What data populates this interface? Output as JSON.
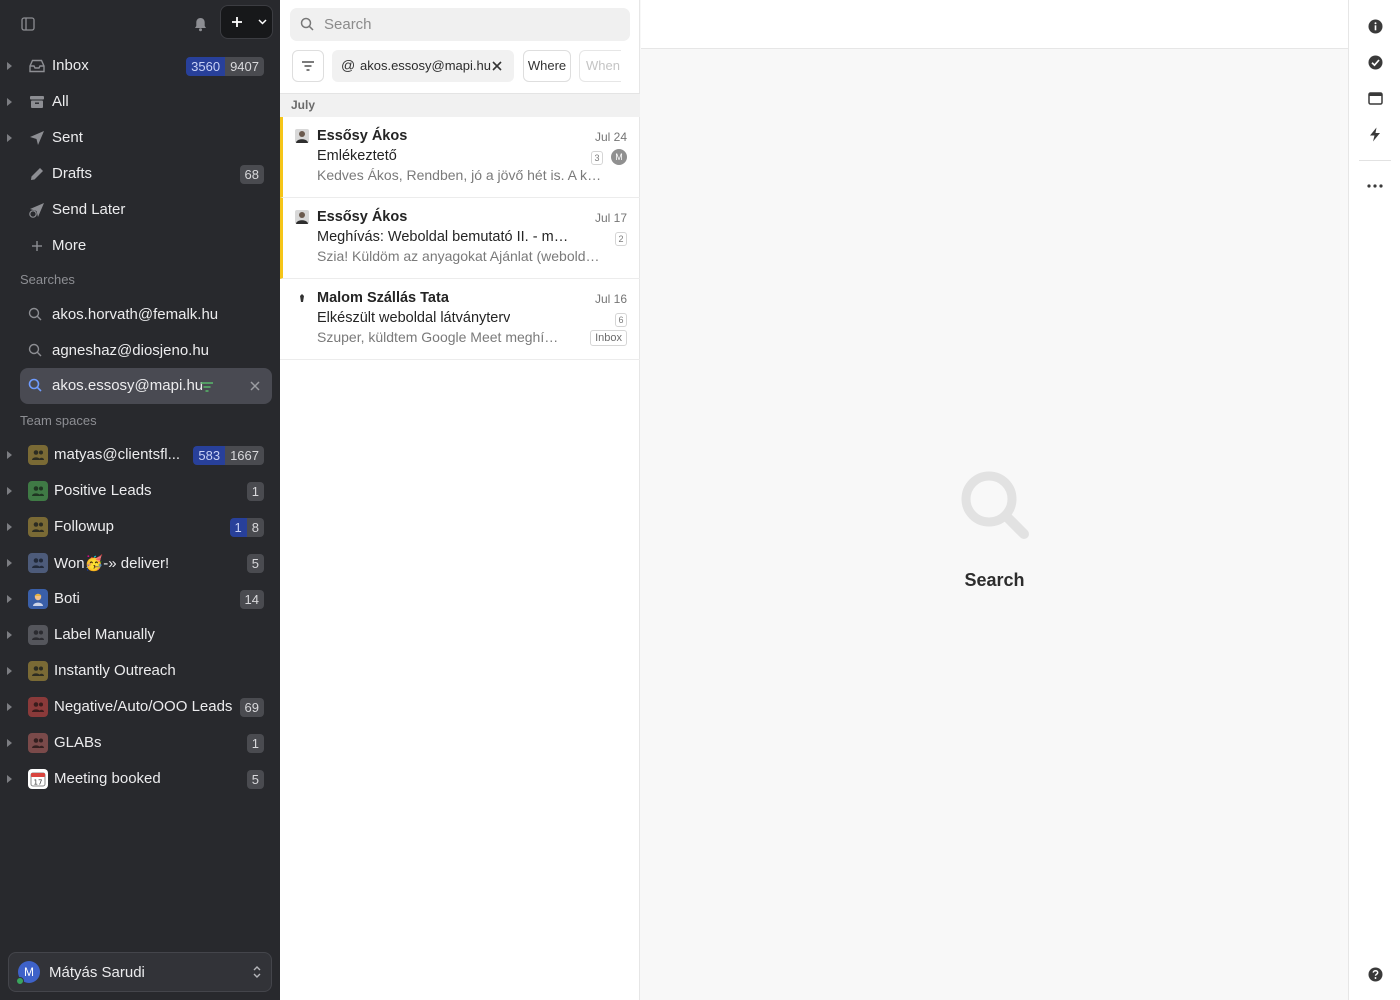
{
  "sidebar": {
    "nav": [
      {
        "label": "Inbox",
        "badge_blue": "3560",
        "badge_grey": "9407"
      },
      {
        "label": "All"
      },
      {
        "label": "Sent"
      },
      {
        "label": "Drafts",
        "badge_grey": "68"
      },
      {
        "label": "Send Later"
      },
      {
        "label": "More"
      }
    ],
    "searches_heading": "Searches",
    "searches": [
      {
        "label": "akos.horvath@femalk.hu"
      },
      {
        "label": "agneshaz@diosjeno.hu"
      },
      {
        "label": "akos.essosy@mapi.hu"
      }
    ],
    "team_heading": "Team spaces",
    "teams": [
      {
        "label": "matyas@clientsfl...",
        "badge_blue": "583",
        "badge_grey": "1667",
        "color": "#7a6a35"
      },
      {
        "label": "Positive Leads",
        "badge_grey": "1",
        "color": "#3f7a45"
      },
      {
        "label": "Followup",
        "badge_blue": "1",
        "badge_grey": "8",
        "color": "#7a6a35"
      },
      {
        "label": "Won🥳-» deliver!",
        "badge_grey": "5",
        "color": "#4d5b7a"
      },
      {
        "label": "Boti",
        "badge_grey": "14",
        "color": "#3a5fa8"
      },
      {
        "label": "Label Manually",
        "color": "#55565c"
      },
      {
        "label": "Instantly Outreach",
        "color": "#7a6a35"
      },
      {
        "label": "Negative/Auto/OOO Leads",
        "badge_grey": "69",
        "color": "#8a3a3a"
      },
      {
        "label": "GLABs",
        "badge_grey": "1",
        "color": "#7a4a4a"
      },
      {
        "label": "Meeting booked",
        "badge_grey": "5",
        "color": "#ffffff"
      }
    ],
    "user": {
      "name": "Mátyás Sarudi",
      "initial": "M"
    }
  },
  "list": {
    "search_placeholder": "Search",
    "chip_at": "@",
    "chip_label": "akos.essosy@mapi.hu",
    "where_label": "Where",
    "when_label": "When",
    "month": "July",
    "threads": [
      {
        "sender": "Essősy Ákos",
        "date": "Jul 24",
        "subject": "Emlékeztető",
        "count": "3",
        "participant": "M",
        "snippet": "Kedves Ákos, Rendben, jó a jövő hét is. A következő"
      },
      {
        "sender": "Essősy Ákos",
        "date": "Jul 17",
        "subject": "Meghívás: Weboldal bemutató II. - malomszallas",
        "count": "2",
        "snippet": "Szia! Küldöm az anyagokat Ajánlat (weboldal, kampány)"
      },
      {
        "sender": "Malom Szállás Tata",
        "date": "Jul 16",
        "subject": "Elkészült weboldal látványterv",
        "count": "6",
        "snippet": "Szuper, küldtem Google Meet meghívót",
        "label": "Inbox"
      }
    ]
  },
  "main": {
    "empty_title": "Search"
  }
}
